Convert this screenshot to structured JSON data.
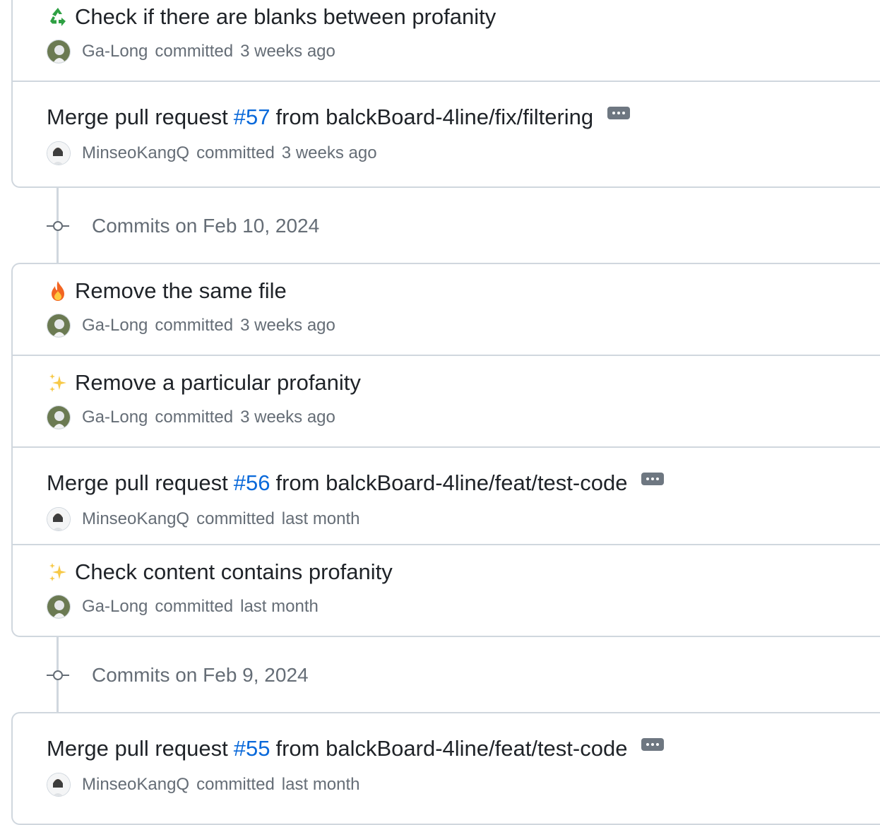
{
  "groups": [
    {
      "commits": [
        {
          "emoji": "recycle-icon",
          "title": "Check if there are blanks between profanity",
          "author": "Ga-Long",
          "action": "committed",
          "when": "3 weeks ago"
        },
        {
          "prefix": "Merge pull request",
          "pr": "#57",
          "suffix": "from balckBoard-4line/fix/filtering",
          "author": "MinseoKangQ",
          "action": "committed",
          "when": "3 weeks ago"
        }
      ]
    },
    {
      "date_label": "Commits on Feb 10, 2024",
      "commits": [
        {
          "emoji": "fire-icon",
          "title": "Remove the same file",
          "author": "Ga-Long",
          "action": "committed",
          "when": "3 weeks ago"
        },
        {
          "emoji": "sparkles-icon",
          "title": "Remove a particular profanity",
          "author": "Ga-Long",
          "action": "committed",
          "when": "3 weeks ago"
        },
        {
          "prefix": "Merge pull request",
          "pr": "#56",
          "suffix": "from balckBoard-4line/feat/test-code",
          "author": "MinseoKangQ",
          "action": "committed",
          "when": "last month"
        },
        {
          "emoji": "sparkles-icon",
          "title": "Check content contains profanity",
          "author": "Ga-Long",
          "action": "committed",
          "when": "last month"
        }
      ]
    },
    {
      "date_label": "Commits on Feb 9, 2024",
      "commits": [
        {
          "prefix": "Merge pull request",
          "pr": "#55",
          "suffix": "from balckBoard-4line/feat/test-code",
          "author": "MinseoKangQ",
          "action": "committed",
          "when": "last month"
        }
      ]
    }
  ]
}
